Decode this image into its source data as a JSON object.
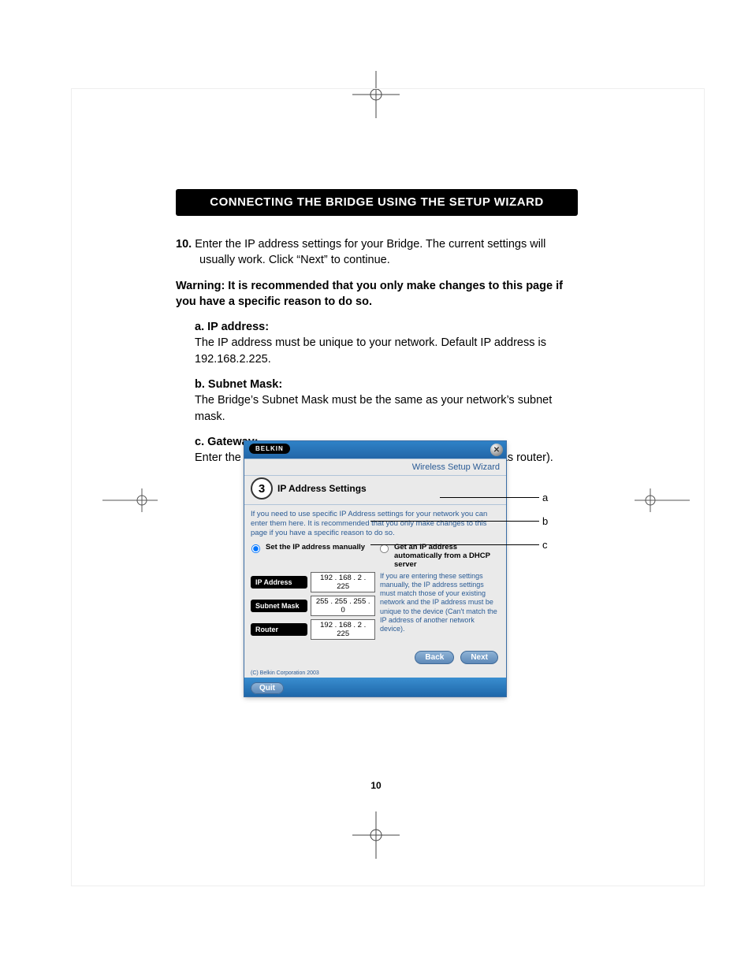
{
  "page": {
    "title_ribbon": "CONNECTING THE BRIDGE USING THE SETUP WIZARD",
    "page_number": "10"
  },
  "doc": {
    "step_number": "10.",
    "step_text": "Enter the IP address settings for your Bridge. The current settings will usually work. Click “Next” to continue.",
    "warning": "Warning: It is recommended that you only make changes to this page if you have a specific reason to do so.",
    "a_head": "a. IP address:",
    "a_text": "The IP address must be unique to your network. Default IP address is 192.168.2.225.",
    "b_head": "b. Subnet Mask:",
    "b_text": "The Bridge’s Subnet Mask must be the same as your network’s subnet mask.",
    "c_head": "c. Gateway:",
    "c_text": "Enter the IP address of your network’s gateway (also known as router)."
  },
  "callouts": {
    "a": "a",
    "b": "b",
    "c": "c"
  },
  "wizard": {
    "brand": "BELKIN",
    "close_glyph": "✕",
    "header_right": "Wireless Setup Wizard",
    "step_number": "3",
    "step_title": "IP Address Settings",
    "info": "If you need to use specific IP Address settings for your network you can enter them here. It is recommended that you only make changes to this page if you have a specific reason to do so.",
    "radio_manual": "Set the IP address manually",
    "radio_dhcp": "Get an IP address automatically from a DHCP server",
    "fields": {
      "ip_label": "IP Address",
      "ip_value": "192 . 168 .  2  . 225",
      "mask_label": "Subnet Mask",
      "mask_value": "255 . 255 . 255 .  0",
      "router_label": "Router",
      "router_value": "192 . 168 .  2  . 225"
    },
    "tip": "If you are entering these settings manually, the IP address settings must match those of your existing network and the IP address must be unique to the device (Can't match the IP address of another network device).",
    "buttons": {
      "back": "Back",
      "next": "Next",
      "quit": "Quit"
    },
    "copyright": "(C) Belkin Corporation 2003"
  }
}
